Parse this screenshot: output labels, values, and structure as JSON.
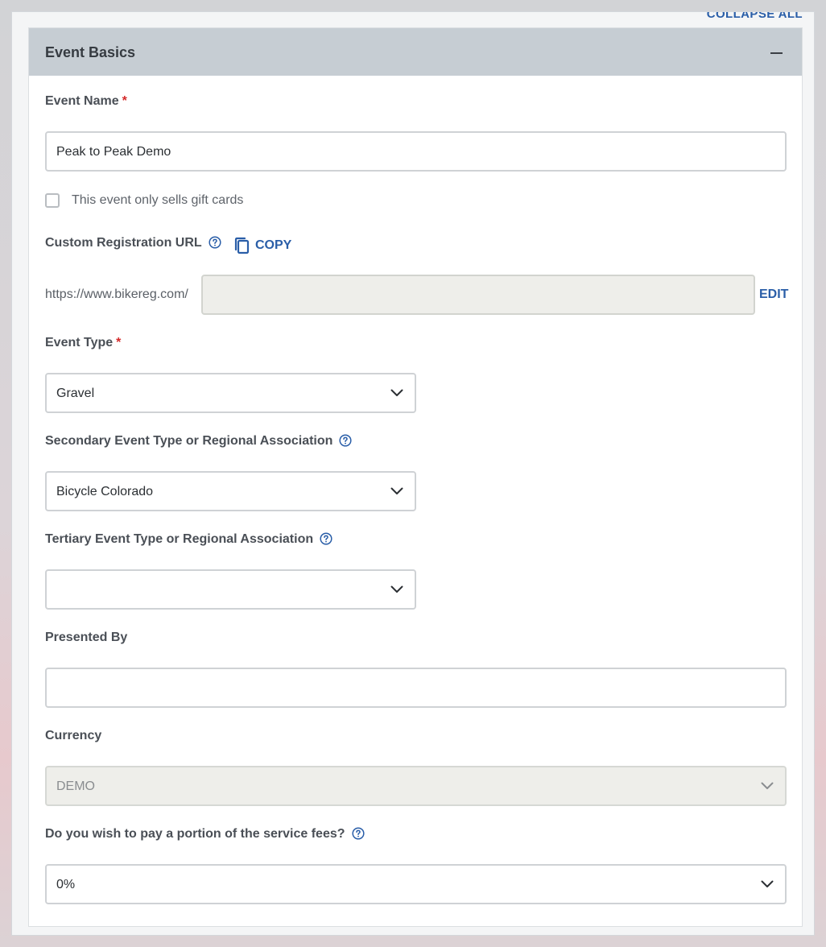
{
  "top_link": "COLLAPSE ALL",
  "section": {
    "title": "Event Basics"
  },
  "event_name": {
    "label": "Event Name",
    "required_mark": "*",
    "value": "Peak to Peak Demo"
  },
  "gift_cards": {
    "label": "This event only sells gift cards",
    "checked": false
  },
  "registration_url": {
    "label": "Custom Registration URL",
    "copy_label": "COPY",
    "prefix": "https://www.bikereg.com/",
    "value": "",
    "edit_label": "EDIT"
  },
  "event_type": {
    "label": "Event Type",
    "required_mark": "*",
    "selected": "Gravel"
  },
  "secondary_type": {
    "label": "Secondary Event Type or Regional Association",
    "selected": "Bicycle Colorado"
  },
  "tertiary_type": {
    "label": "Tertiary Event Type or Regional Association",
    "selected": ""
  },
  "presented_by": {
    "label": "Presented By",
    "value": ""
  },
  "currency": {
    "label": "Currency",
    "selected": "DEMO",
    "disabled": true
  },
  "service_fees": {
    "label": "Do you wish to pay a portion of the service fees?",
    "selected": "0%"
  },
  "colors": {
    "link": "#2a5ea8",
    "required": "#d42a2a",
    "header_bg": "#c6cdd3"
  },
  "icons": [
    "help-icon",
    "copy-icon",
    "chevron-down-icon",
    "collapse-icon"
  ]
}
